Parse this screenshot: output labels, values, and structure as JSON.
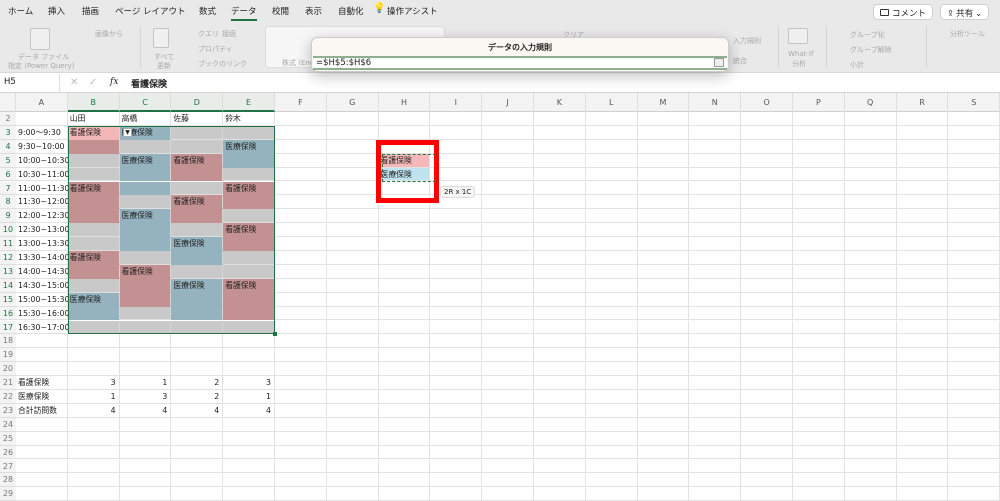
{
  "tabs": [
    "ホーム",
    "挿入",
    "描画",
    "ページ レイアウト",
    "数式",
    "データ",
    "校閲",
    "表示",
    "自動化"
  ],
  "active_tab": "データ",
  "tell_me": "操作アシスト",
  "comment_btn": "コメント",
  "share_btn": "共有",
  "ribbon": {
    "get_data": "データ ファイル",
    "get_data2": "指定 (Power Query)",
    "from_image": "画像から",
    "refresh_all": "すべて",
    "refresh_all2": "更新",
    "queries": "クエリ",
    "connections": "接続",
    "properties": "プロパティ",
    "workbook_links": "ブックのリンク",
    "stocks": "株式 (Eng",
    "clear": "クリア",
    "validation": "入力規則",
    "consolidate": "統合",
    "whatif": "What-If",
    "whatif2": "分析",
    "group": "グループ化",
    "ungroup": "グループ解除",
    "subtotal": "小計",
    "analysis": "分析ツール"
  },
  "formula_bar": {
    "name_box": "H5",
    "fx": "fx",
    "value": "看護保険"
  },
  "dialog": {
    "title": "データの入力規則",
    "value": "=$H$5:$H$6"
  },
  "columns": [
    "A",
    "B",
    "C",
    "D",
    "E",
    "F",
    "G",
    "H",
    "I",
    "J",
    "K",
    "L",
    "M",
    "N",
    "O",
    "P",
    "Q",
    "R",
    "S"
  ],
  "row_numbers": [
    2,
    3,
    4,
    5,
    6,
    7,
    8,
    9,
    10,
    11,
    12,
    13,
    14,
    15,
    16,
    17,
    18,
    19,
    20,
    21,
    22,
    23,
    24,
    25,
    26,
    27,
    28,
    29
  ],
  "colors": {
    "nursing": "#c39191",
    "medical": "#94b3bf",
    "empty": "#c9c9c9",
    "active": "#f3b7b7",
    "list_nursing": "#f4b8b8",
    "list_medical": "#bfe3f1",
    "accent": "#217346"
  },
  "headers": [
    "山田",
    "高橋",
    "佐藤",
    "鈴木"
  ],
  "schedule": [
    {
      "time": "9:00～9:30",
      "cells": [
        [
          "看護保険",
          "active"
        ],
        [
          "医療保険",
          "medical"
        ],
        [
          "",
          "empty"
        ],
        [
          "",
          "empty"
        ]
      ]
    },
    {
      "time": "9:30~10:00",
      "cells": [
        [
          "",
          "nursing"
        ],
        [
          "",
          "empty"
        ],
        [
          "",
          "empty"
        ],
        [
          "医療保険",
          "medical"
        ]
      ]
    },
    {
      "time": "10:00~10:30",
      "cells": [
        [
          "",
          "empty"
        ],
        [
          "医療保険",
          "medical"
        ],
        [
          "看護保険",
          "nursing"
        ],
        [
          "",
          "medical"
        ]
      ]
    },
    {
      "time": "10:30~11:00",
      "cells": [
        [
          "",
          "empty"
        ],
        [
          "",
          "medical"
        ],
        [
          "",
          "nursing"
        ],
        [
          "",
          "empty"
        ]
      ]
    },
    {
      "time": "11:00~11:30",
      "cells": [
        [
          "看護保険",
          "nursing"
        ],
        [
          "",
          "medical"
        ],
        [
          "",
          "empty"
        ],
        [
          "看護保険",
          "nursing"
        ]
      ]
    },
    {
      "time": "11:30~12:00",
      "cells": [
        [
          "",
          "nursing"
        ],
        [
          "",
          "empty"
        ],
        [
          "看護保険",
          "nursing"
        ],
        [
          "",
          "nursing"
        ]
      ]
    },
    {
      "time": "12:00~12:30",
      "cells": [
        [
          "",
          "nursing"
        ],
        [
          "医療保険",
          "medical"
        ],
        [
          "",
          "nursing"
        ],
        [
          "",
          "empty"
        ]
      ]
    },
    {
      "time": "12:30~13:00",
      "cells": [
        [
          "",
          "empty"
        ],
        [
          "",
          "medical"
        ],
        [
          "",
          "empty"
        ],
        [
          "看護保険",
          "nursing"
        ]
      ]
    },
    {
      "time": "13:00~13:30",
      "cells": [
        [
          "",
          "empty"
        ],
        [
          "",
          "medical"
        ],
        [
          "医療保険",
          "medical"
        ],
        [
          "",
          "nursing"
        ]
      ]
    },
    {
      "time": "13:30~14:00",
      "cells": [
        [
          "看護保険",
          "nursing"
        ],
        [
          "",
          "empty"
        ],
        [
          "",
          "medical"
        ],
        [
          "",
          "empty"
        ]
      ]
    },
    {
      "time": "14:00~14:30",
      "cells": [
        [
          "",
          "nursing"
        ],
        [
          "看護保険",
          "nursing"
        ],
        [
          "",
          "empty"
        ],
        [
          "",
          "empty"
        ]
      ]
    },
    {
      "time": "14:30~15:00",
      "cells": [
        [
          "",
          "empty"
        ],
        [
          "",
          "nursing"
        ],
        [
          "医療保険",
          "medical"
        ],
        [
          "看護保険",
          "nursing"
        ]
      ]
    },
    {
      "time": "15:00~15:30",
      "cells": [
        [
          "医療保険",
          "medical"
        ],
        [
          "",
          "nursing"
        ],
        [
          "",
          "medical"
        ],
        [
          "",
          "nursing"
        ]
      ]
    },
    {
      "time": "15:30~16:00",
      "cells": [
        [
          "",
          "medical"
        ],
        [
          "",
          "empty"
        ],
        [
          "",
          "medical"
        ],
        [
          "",
          "nursing"
        ]
      ]
    },
    {
      "time": "16:30~17:00",
      "cells": [
        [
          "",
          "empty"
        ],
        [
          "",
          "empty"
        ],
        [
          "",
          "empty"
        ],
        [
          "",
          "empty"
        ]
      ]
    }
  ],
  "summary": [
    {
      "label": "看護保険",
      "values": [
        3,
        1,
        2,
        3
      ]
    },
    {
      "label": "医療保険",
      "values": [
        1,
        3,
        2,
        1
      ]
    },
    {
      "label": "合計訪問数",
      "values": [
        4,
        4,
        4,
        4
      ]
    }
  ],
  "list_source": [
    [
      "看護保険",
      "list_nursing"
    ],
    [
      "医療保険",
      "list_medical"
    ]
  ],
  "selection_tooltip": "2R x 1C"
}
